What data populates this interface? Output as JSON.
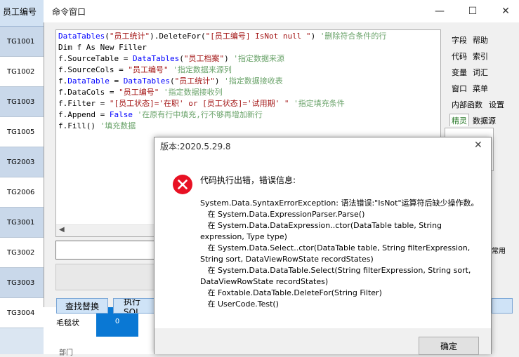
{
  "grid": {
    "header": "员工编号",
    "rows": [
      "TG1001",
      "TG1002",
      "TG1003",
      "TG1005",
      "TG2003",
      "TG2006",
      "TG3001",
      "TG3002",
      "TG3003",
      "TG3004"
    ],
    "bottom_cells": [
      "毛毯状",
      "0"
    ],
    "bottom_fragment": "部门"
  },
  "window": {
    "title": "命令窗口",
    "minimize": "—",
    "maximize": "☐",
    "close": "✕"
  },
  "code": {
    "lines": [
      [
        {
          "t": "DataTables",
          "c": "kw"
        },
        {
          "t": "(",
          "c": ""
        },
        {
          "t": "\"员工统计\"",
          "c": "str"
        },
        {
          "t": ").DeleteFor(",
          "c": ""
        },
        {
          "t": "\"[员工编号] IsNot null \"",
          "c": "str"
        },
        {
          "t": ") ",
          "c": ""
        },
        {
          "t": "'删除符合条件的行",
          "c": "cm"
        }
      ],
      [
        {
          "t": "Dim f As New Filler",
          "c": ""
        }
      ],
      [
        {
          "t": "f.SourceTable = ",
          "c": ""
        },
        {
          "t": "DataTables",
          "c": "kw"
        },
        {
          "t": "(",
          "c": ""
        },
        {
          "t": "\"员工档案\"",
          "c": "str"
        },
        {
          "t": ") ",
          "c": ""
        },
        {
          "t": "'指定数据来源",
          "c": "cm"
        }
      ],
      [
        {
          "t": "f.SourceCols = ",
          "c": ""
        },
        {
          "t": "\"员工编号\"",
          "c": "str"
        },
        {
          "t": " ",
          "c": ""
        },
        {
          "t": "'指定数据来源列",
          "c": "cm"
        }
      ],
      [
        {
          "t": "f.",
          "c": ""
        },
        {
          "t": "DataTable",
          "c": "kw"
        },
        {
          "t": " = ",
          "c": ""
        },
        {
          "t": "DataTables",
          "c": "kw"
        },
        {
          "t": "(",
          "c": ""
        },
        {
          "t": "\"员工统计\"",
          "c": "str"
        },
        {
          "t": ") ",
          "c": ""
        },
        {
          "t": "'指定数据接收表",
          "c": "cm"
        }
      ],
      [
        {
          "t": "f.DataCols = ",
          "c": ""
        },
        {
          "t": "\"员工编号\"",
          "c": "str"
        },
        {
          "t": " ",
          "c": ""
        },
        {
          "t": "'指定数据接收列",
          "c": "cm"
        }
      ],
      [
        {
          "t": "f.Filter = ",
          "c": ""
        },
        {
          "t": "\"[员工状态]='在职' or [员工状态]='试用期' \"",
          "c": "str"
        },
        {
          "t": " ",
          "c": ""
        },
        {
          "t": "'指定填充条件",
          "c": "cm"
        }
      ],
      [
        {
          "t": "f.Append = ",
          "c": ""
        },
        {
          "t": "False",
          "c": "kw"
        },
        {
          "t": " ",
          "c": ""
        },
        {
          "t": "'在原有行中填充,行不够再增加新行",
          "c": "cm"
        }
      ],
      [
        {
          "t": "f.Fill() ",
          "c": ""
        },
        {
          "t": "'填充数据",
          "c": "cm"
        }
      ]
    ]
  },
  "buttons": {
    "find_replace": "查找替换",
    "exec_sql": "执行SQL",
    "common": "常用"
  },
  "right_panel": {
    "items": [
      [
        "字段",
        "帮助"
      ],
      [
        "代码",
        "索引"
      ],
      [
        "变量",
        "词汇"
      ],
      [
        "窗口",
        "菜单"
      ],
      [
        "内部函数",
        "设置"
      ]
    ],
    "tabs": [
      "精灵",
      "数据源"
    ]
  },
  "dialog": {
    "title": "版本:2020.5.29.8",
    "heading": "代码执行出错，错误信息:",
    "lines": [
      "System.Data.SyntaxErrorException: 语法错误:\"IsNot\"运算符后缺少操作数。",
      "   在 System.Data.ExpressionParser.Parse()",
      "   在 System.Data.DataExpression..ctor(DataTable table, String",
      "expression, Type type)",
      "   在 System.Data.Select..ctor(DataTable table, String filterExpression,",
      "String sort, DataViewRowState recordStates)",
      "   在 System.Data.DataTable.Select(String filterExpression, String sort,",
      "DataViewRowState recordStates)",
      "   在 Foxtable.DataTable.DeleteFor(String Filter)",
      "   在 UserCode.Test()"
    ],
    "ok": "确定",
    "close": "✕"
  },
  "colors": {
    "error_red": "#e81123",
    "keyword_blue": "#0000ff",
    "string_red": "#a31515",
    "comment_green": "#6aa36a"
  }
}
